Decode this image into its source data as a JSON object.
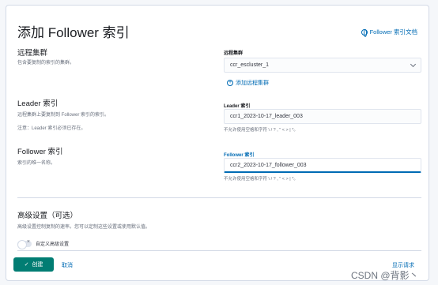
{
  "page": {
    "title": "添加 Follower 索引"
  },
  "doc_link": {
    "label": "Follower 索引文档"
  },
  "remote_cluster": {
    "title": "远程集群",
    "desc": "包含要复制的索引的集群。",
    "field_label": "远程集群",
    "selected": "ccr_escluster_1",
    "add_link": "添加远程集群"
  },
  "leader": {
    "title": "Leader 索引",
    "desc": "远程集群上要复制到 Follower 索引的索引。",
    "note": "注意：Leader 索引必须已存在。",
    "field_label": "Leader 索引",
    "value": "ccr1_2023-10-17_leader_003",
    "hint": "不允许使用空格和字符 \\ / ? , \" < > | *。"
  },
  "follower": {
    "title": "Follower 索引",
    "desc": "索引的唯一名称。",
    "field_label": "Follower 索引",
    "value": "ccr2_2023-10-17_follower_003",
    "hint": "不允许使用空格和字符 \\ / ? , \" < > | *。"
  },
  "advanced": {
    "title": "高级设置（可选）",
    "desc": "高级设置控制复制的速率。您可以定制这些设置或使用默认值。",
    "toggle_label": "自定义高级设置"
  },
  "actions": {
    "create": "创建",
    "cancel": "取消",
    "show_request": "显示请求"
  },
  "watermark": "CSDN @背影丶"
}
